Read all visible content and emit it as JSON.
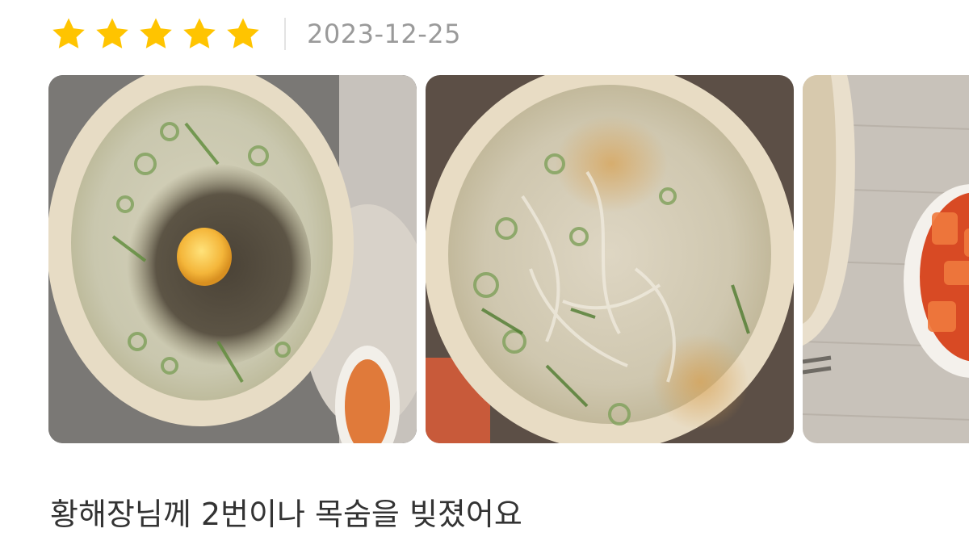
{
  "review": {
    "rating": 5,
    "rating_max": 5,
    "star_color": "#FFC400",
    "date": "2023-12-25",
    "text": "황해장님께 2번이나 목숨을 빚졌어요",
    "photos": [
      {
        "icon": "soup-bowl-with-egg-photo"
      },
      {
        "icon": "soup-bowl-noodles-photo"
      },
      {
        "icon": "kimchi-side-dish-photo"
      }
    ]
  }
}
